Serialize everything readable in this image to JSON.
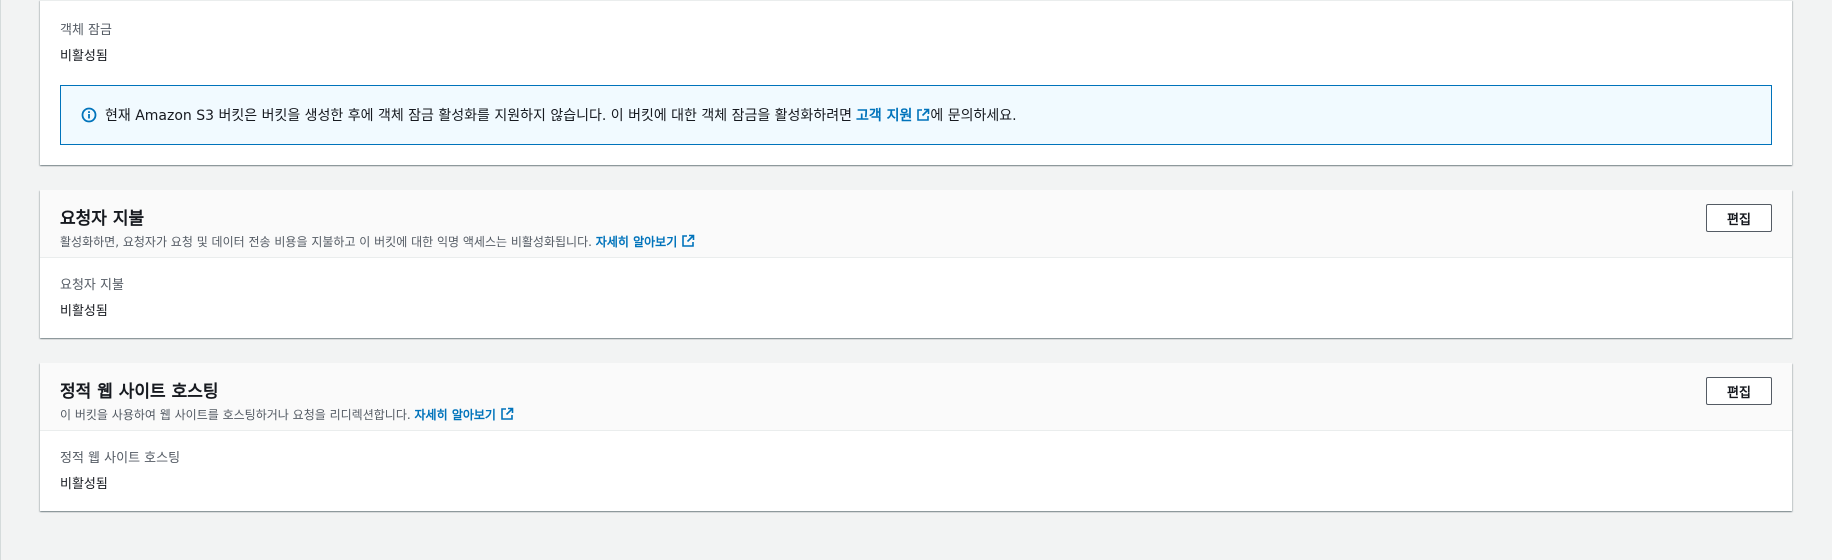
{
  "object_lock": {
    "label": "객체 잠금",
    "value": "비활성됨",
    "info": {
      "text_before": "현재 Amazon S3 버킷은 버킷을 생성한 후에 객체 잠금 활성화를 지원하지 않습니다. 이 버킷에 대한 객체 잠금을 활성화하려면",
      "link": "고객 지원",
      "text_after": "에 문의하세요.",
      "icon": "info-icon"
    }
  },
  "requester_pays": {
    "title": "요청자 지불",
    "description": "활성화하면, 요청자가 요청 및 데이터 전송 비용을 지불하고 이 버킷에 대한 익명 액세스는 비활성화됩니다.",
    "learn_more": "자세히 알아보기",
    "edit_label": "편집",
    "label": "요청자 지불",
    "value": "비활성됨"
  },
  "static_hosting": {
    "title": "정적 웹 사이트 호스팅",
    "description": "이 버킷을 사용하여 웹 사이트를 호스팅하거나 요청을 리디렉션합니다.",
    "learn_more": "자세히 알아보기",
    "edit_label": "편집",
    "label": "정적 웹 사이트 호스팅",
    "value": "비활성됨"
  },
  "colors": {
    "link": "#0073bb",
    "info_border": "#0073bb",
    "info_bg": "#f1faff",
    "page_bg": "#f2f3f3"
  }
}
